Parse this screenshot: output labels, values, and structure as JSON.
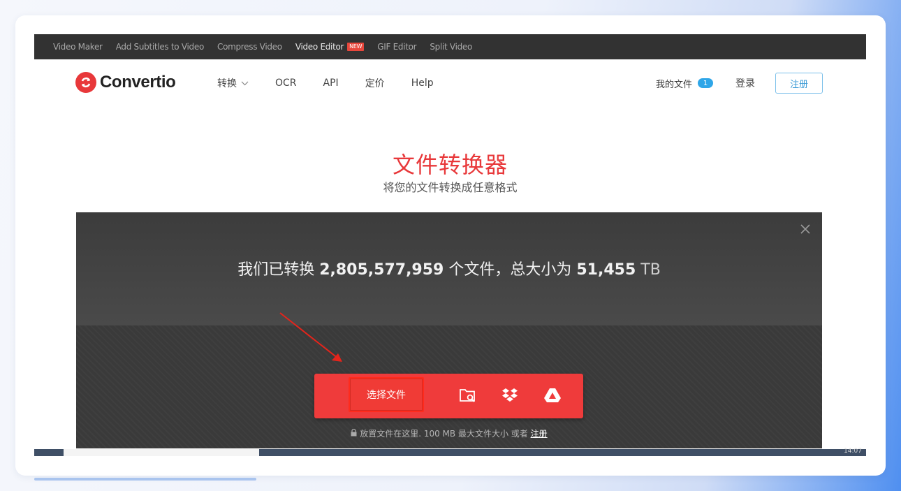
{
  "topstrip": {
    "links": [
      {
        "label": "Video Maker"
      },
      {
        "label": "Add Subtitles to Video"
      },
      {
        "label": "Compress Video"
      },
      {
        "label": "Video Editor",
        "badge": "NEW"
      },
      {
        "label": "GIF Editor"
      },
      {
        "label": "Split Video"
      }
    ]
  },
  "nav": {
    "logo_text": "Convertio",
    "menu": [
      {
        "label": "转换"
      },
      {
        "label": "OCR"
      },
      {
        "label": "API"
      },
      {
        "label": "定价"
      },
      {
        "label": "Help"
      }
    ],
    "my_files": "我的文件",
    "my_files_count": "1",
    "login": "登录",
    "signup": "注册"
  },
  "hero": {
    "title": "文件转换器",
    "subtitle": "将您的文件转换成任意格式"
  },
  "panel": {
    "stats_prefix": "我们已转换",
    "files_count": "2,805,577,959",
    "stats_middle": "个文件，总大小为",
    "total_size": "51,455",
    "size_unit": "TB",
    "choose_files": "选择文件",
    "drop_note": "放置文件在这里. 100 MB 最大文件大小 或者",
    "drop_note_link": "注册"
  },
  "taskbar": {
    "clock": "14:07"
  },
  "colors": {
    "brand_red": "#e8383a",
    "button_red": "#ef3b3b",
    "badge_blue": "#2fa6e8",
    "signup_blue": "#3a9ad6"
  },
  "icons": [
    "convertio-logo-icon",
    "chevron-down-icon",
    "close-icon",
    "folder-search-icon",
    "dropbox-icon",
    "google-drive-icon",
    "lock-icon",
    "annotation-arrow-icon"
  ]
}
